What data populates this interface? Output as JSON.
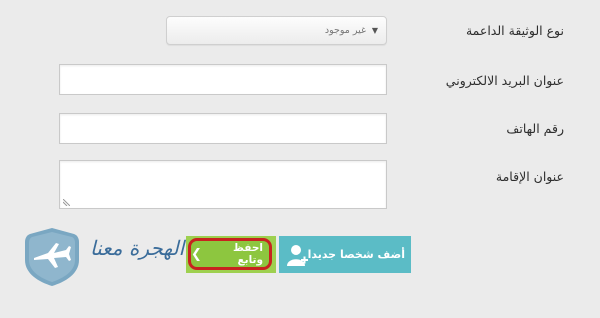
{
  "form": {
    "doc_type_label": "نوع الوثيقة الداعمة",
    "doc_type_value": "غير موجود",
    "email_label": "عنوان البريد الالكتروني",
    "email_value": "",
    "phone_label": "رقم الهاتف",
    "phone_value": "",
    "address_label": "عنوان الإقامة",
    "address_value": ""
  },
  "actions": {
    "add_person_label": "أضف شخصا جديدا",
    "save_continue_label": "احفظ وتابع"
  },
  "brand": {
    "text": "الهجرة معنا",
    "logo_icon": "airplane-shield-icon"
  },
  "colors": {
    "add_button": "#5bbcc6",
    "save_button": "#8dc63f",
    "highlight_ring": "#c7231f",
    "brand": "#3a6c9a"
  }
}
